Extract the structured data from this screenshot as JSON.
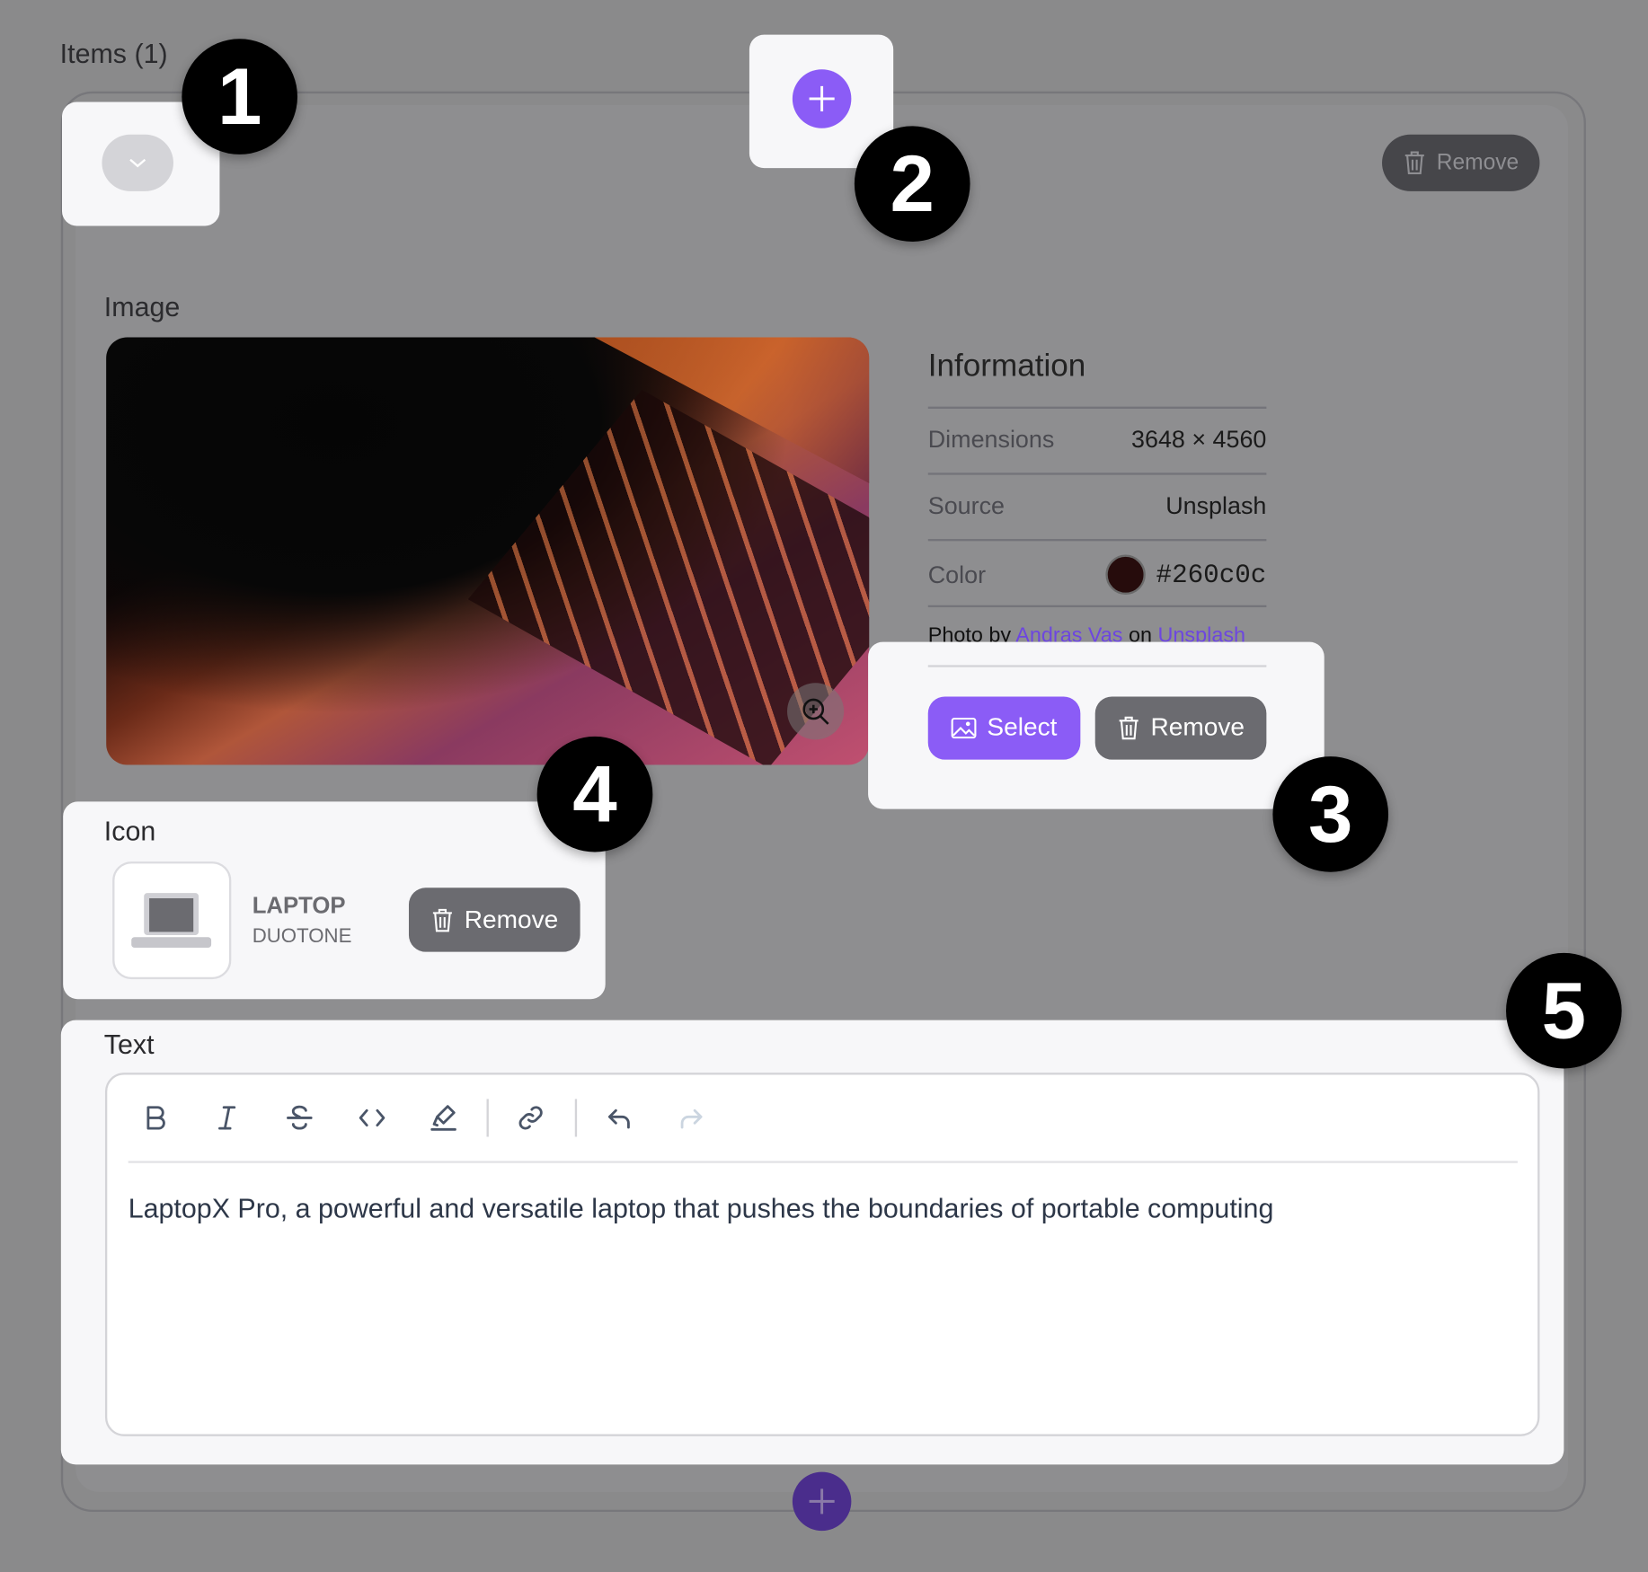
{
  "items_label": "Items (1)",
  "header": {
    "remove_label": "Remove"
  },
  "image_section": {
    "label": "Image",
    "info_title": "Information",
    "rows": [
      {
        "key": "Dimensions",
        "value": "3648 × 4560"
      },
      {
        "key": "Source",
        "value": "Unsplash"
      },
      {
        "key": "Color",
        "value": "#260c0c"
      }
    ],
    "credit": {
      "prefix": "Photo by",
      "author": "Andras Vas",
      "middle": "on",
      "site": "Unsplash"
    },
    "select_label": "Select",
    "remove_label": "Remove"
  },
  "icon_section": {
    "label": "Icon",
    "name": "LAPTOP",
    "style": "DUOTONE",
    "remove_label": "Remove"
  },
  "text_section": {
    "label": "Text",
    "toolbar": [
      "bold-icon",
      "italic-icon",
      "strikethrough-icon",
      "code-icon",
      "highlight-icon",
      "link-icon",
      "undo-icon",
      "redo-icon"
    ],
    "content": "LaptopX Pro, a powerful and versatile laptop that pushes the boundaries of portable computing"
  },
  "badges": [
    "1",
    "2",
    "3",
    "4",
    "5"
  ],
  "colors": {
    "accent": "#8b5cf6",
    "swatch": "#260c0c",
    "link": "#6d46e0"
  }
}
